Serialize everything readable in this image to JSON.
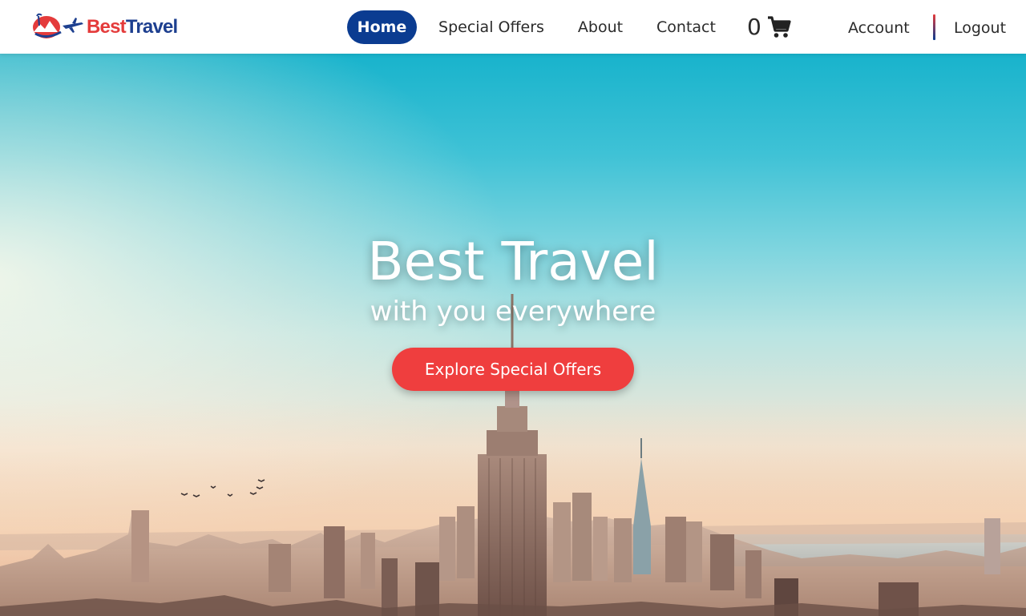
{
  "brand": {
    "name_part1": "Best",
    "name_part2": "Travel",
    "colors": {
      "red": "#e43b3b",
      "blue": "#1d3f8f"
    }
  },
  "nav": {
    "items": [
      {
        "label": "Home",
        "active": true
      },
      {
        "label": "Special Offers",
        "active": false
      },
      {
        "label": "About",
        "active": false
      },
      {
        "label": "Contact",
        "active": false
      }
    ],
    "cart": {
      "count": "0",
      "icon": "shopping-cart-icon"
    },
    "account_label": "Account",
    "logout_label": "Logout",
    "active_color": "#0b3c91"
  },
  "hero": {
    "title": "Best Travel",
    "subtitle": "with you everywhere",
    "cta_label": "Explore Special Offers",
    "cta_color": "#ef3e3e"
  }
}
